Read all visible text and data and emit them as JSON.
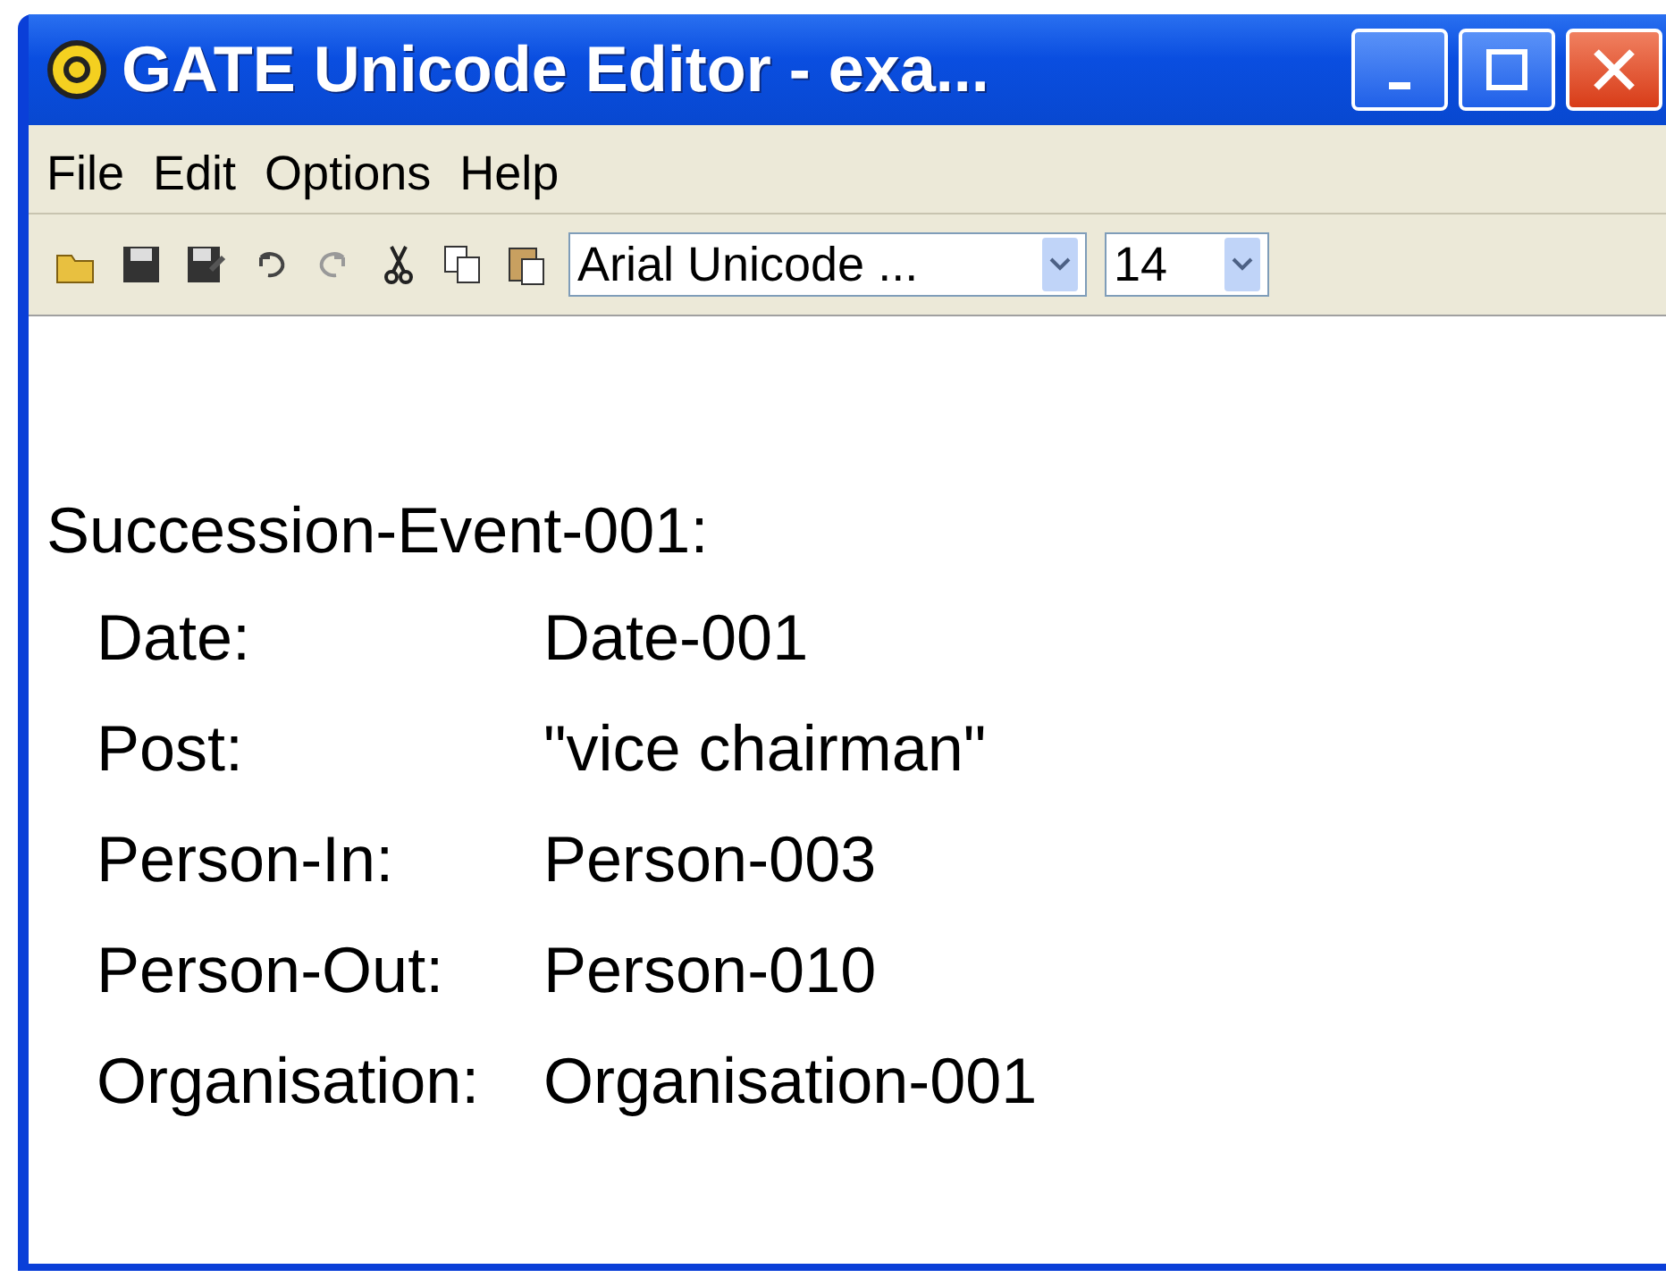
{
  "window": {
    "title": "GATE Unicode Editor - exa..."
  },
  "menu": [
    "File",
    "Edit",
    "Options",
    "Help"
  ],
  "toolbar": {
    "font": "Arial Unicode ...",
    "size": "14"
  },
  "document": {
    "heading": "Succession-Event-001:",
    "fields": [
      {
        "label": "Date:",
        "value": "Date-001"
      },
      {
        "label": "Post:",
        "value": "\"vice chairman\""
      },
      {
        "label": "Person-In:",
        "value": "Person-003"
      },
      {
        "label": "Person-Out:",
        "value": "Person-010"
      },
      {
        "label": "Organisation:",
        "value": "Organisation-001"
      }
    ]
  }
}
